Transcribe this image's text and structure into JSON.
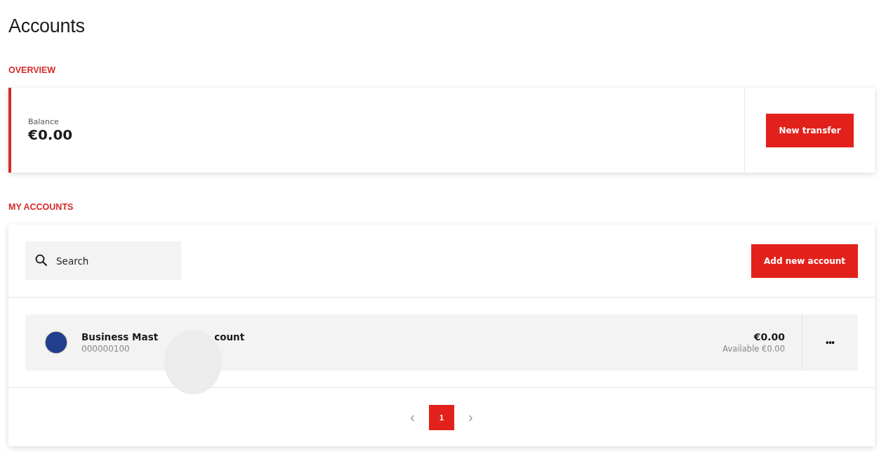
{
  "title": "Accounts",
  "overview": {
    "heading": "OVERVIEW",
    "balance_label": "Balance",
    "balance": "€0.00",
    "button": "New transfer"
  },
  "my_accounts": {
    "heading": "MY ACCOUNTS",
    "search": {
      "placeholder": "Search"
    },
    "add_button": "Add new account",
    "accounts": [
      {
        "name_start": "Business Mast",
        "name_end": "count",
        "number": "000000100",
        "balance": "€0.00",
        "available": "Available €0.00",
        "menu": "•••"
      }
    ],
    "pagination": {
      "prev": "‹",
      "next": "›",
      "pages": [
        {
          "label": "1",
          "selected": true
        }
      ]
    }
  }
}
